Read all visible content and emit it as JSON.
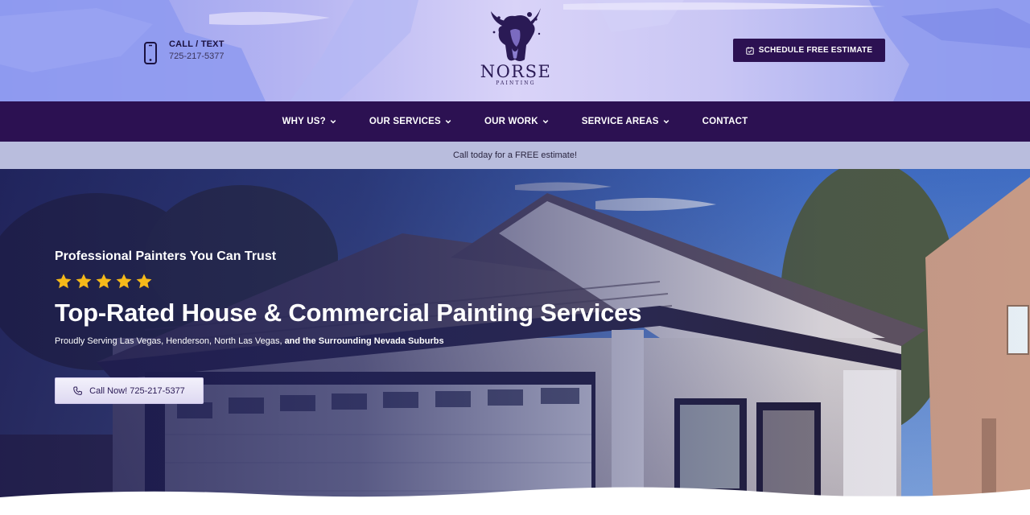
{
  "header": {
    "call_title": "CALL / TEXT",
    "call_number": "725-217-5377",
    "logo_name": "NORSE",
    "logo_sub": "PAINTING",
    "cta_label": "SCHEDULE FREE ESTIMATE"
  },
  "nav": {
    "items": [
      {
        "label": "WHY US?",
        "has_dropdown": true
      },
      {
        "label": "OUR SERVICES",
        "has_dropdown": true
      },
      {
        "label": "OUR WORK",
        "has_dropdown": true
      },
      {
        "label": "SERVICE AREAS",
        "has_dropdown": true
      },
      {
        "label": "CONTACT",
        "has_dropdown": false
      }
    ]
  },
  "notice": {
    "text": "Call today for a FREE estimate!"
  },
  "hero": {
    "kicker": "Professional Painters You Can Trust",
    "rating": 5,
    "title": "Top-Rated House & Commercial Painting Services",
    "sub_plain": "Proudly Serving Las Vegas, Henderson, North Las Vegas, ",
    "sub_bold": "and the Surrounding Nevada Suburbs",
    "call_label": "Call Now! 725-217-5377"
  },
  "colors": {
    "brand_purple": "#2c1152",
    "notice_bg": "#b9bddd",
    "star_yellow": "#f5b91a"
  },
  "icons": {
    "header_phone": "mobile-phone-icon",
    "cta": "calendar-icon",
    "dropdown": "chevron-down-icon",
    "star": "star-icon",
    "call_now": "phone-handset-icon",
    "logo": "viking-head-logo"
  }
}
